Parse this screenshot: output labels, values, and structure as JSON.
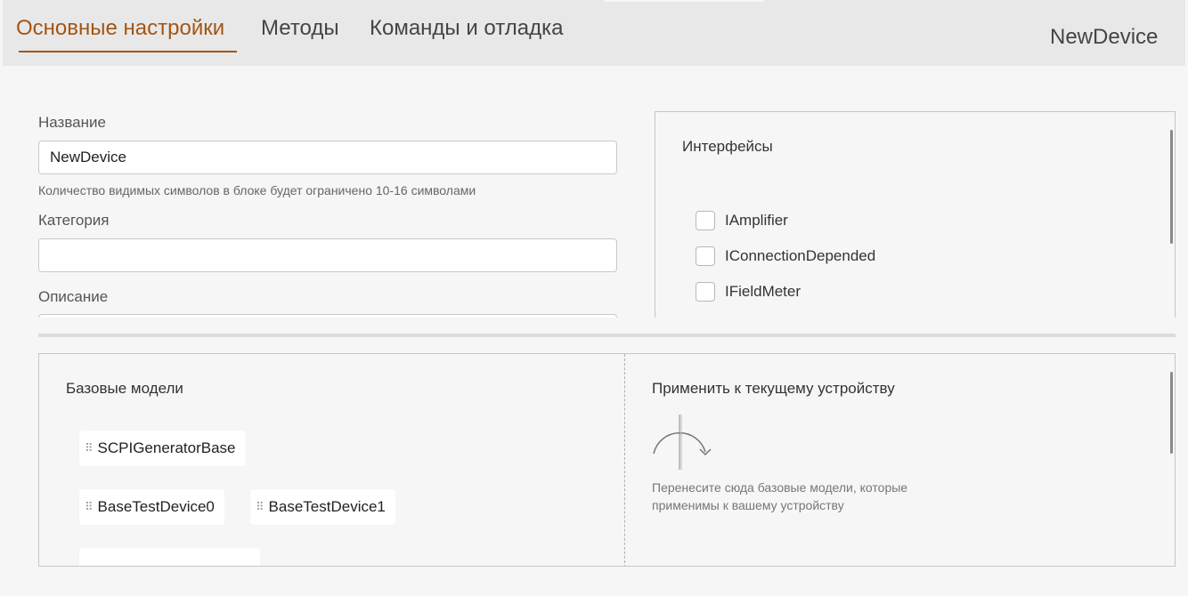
{
  "tabs": [
    {
      "label": "Основные настройки",
      "active": true
    },
    {
      "label": "Методы",
      "active": false
    },
    {
      "label": "Команды и отладка",
      "active": false
    }
  ],
  "header": {
    "device_name": "NewDevice"
  },
  "form": {
    "name_label": "Название",
    "name_value": "NewDevice",
    "name_hint": "Количество видимых символов в блоке будет ограничено 10-16 символами",
    "category_label": "Категория",
    "category_value": "",
    "description_label": "Описание"
  },
  "interfaces": {
    "title": "Интерфейсы",
    "items": [
      {
        "label": "IAmplifier",
        "checked": false
      },
      {
        "label": "IConnectionDepended",
        "checked": false
      },
      {
        "label": "IFieldMeter",
        "checked": false
      }
    ]
  },
  "base_models": {
    "title": "Базовые модели",
    "items": [
      "SCPIGeneratorBase",
      "BaseTestDevice0",
      "BaseTestDevice1"
    ]
  },
  "apply_zone": {
    "title": "Применить к текущему устройству",
    "hint": "Перенесите сюда базовые модели, которые применимы к вашему устройству",
    "icon": "drag-drop-arc-icon"
  },
  "colors": {
    "accent": "#a35515",
    "header_bg": "#e8e8e8",
    "page_bg": "#f6f6f6"
  }
}
